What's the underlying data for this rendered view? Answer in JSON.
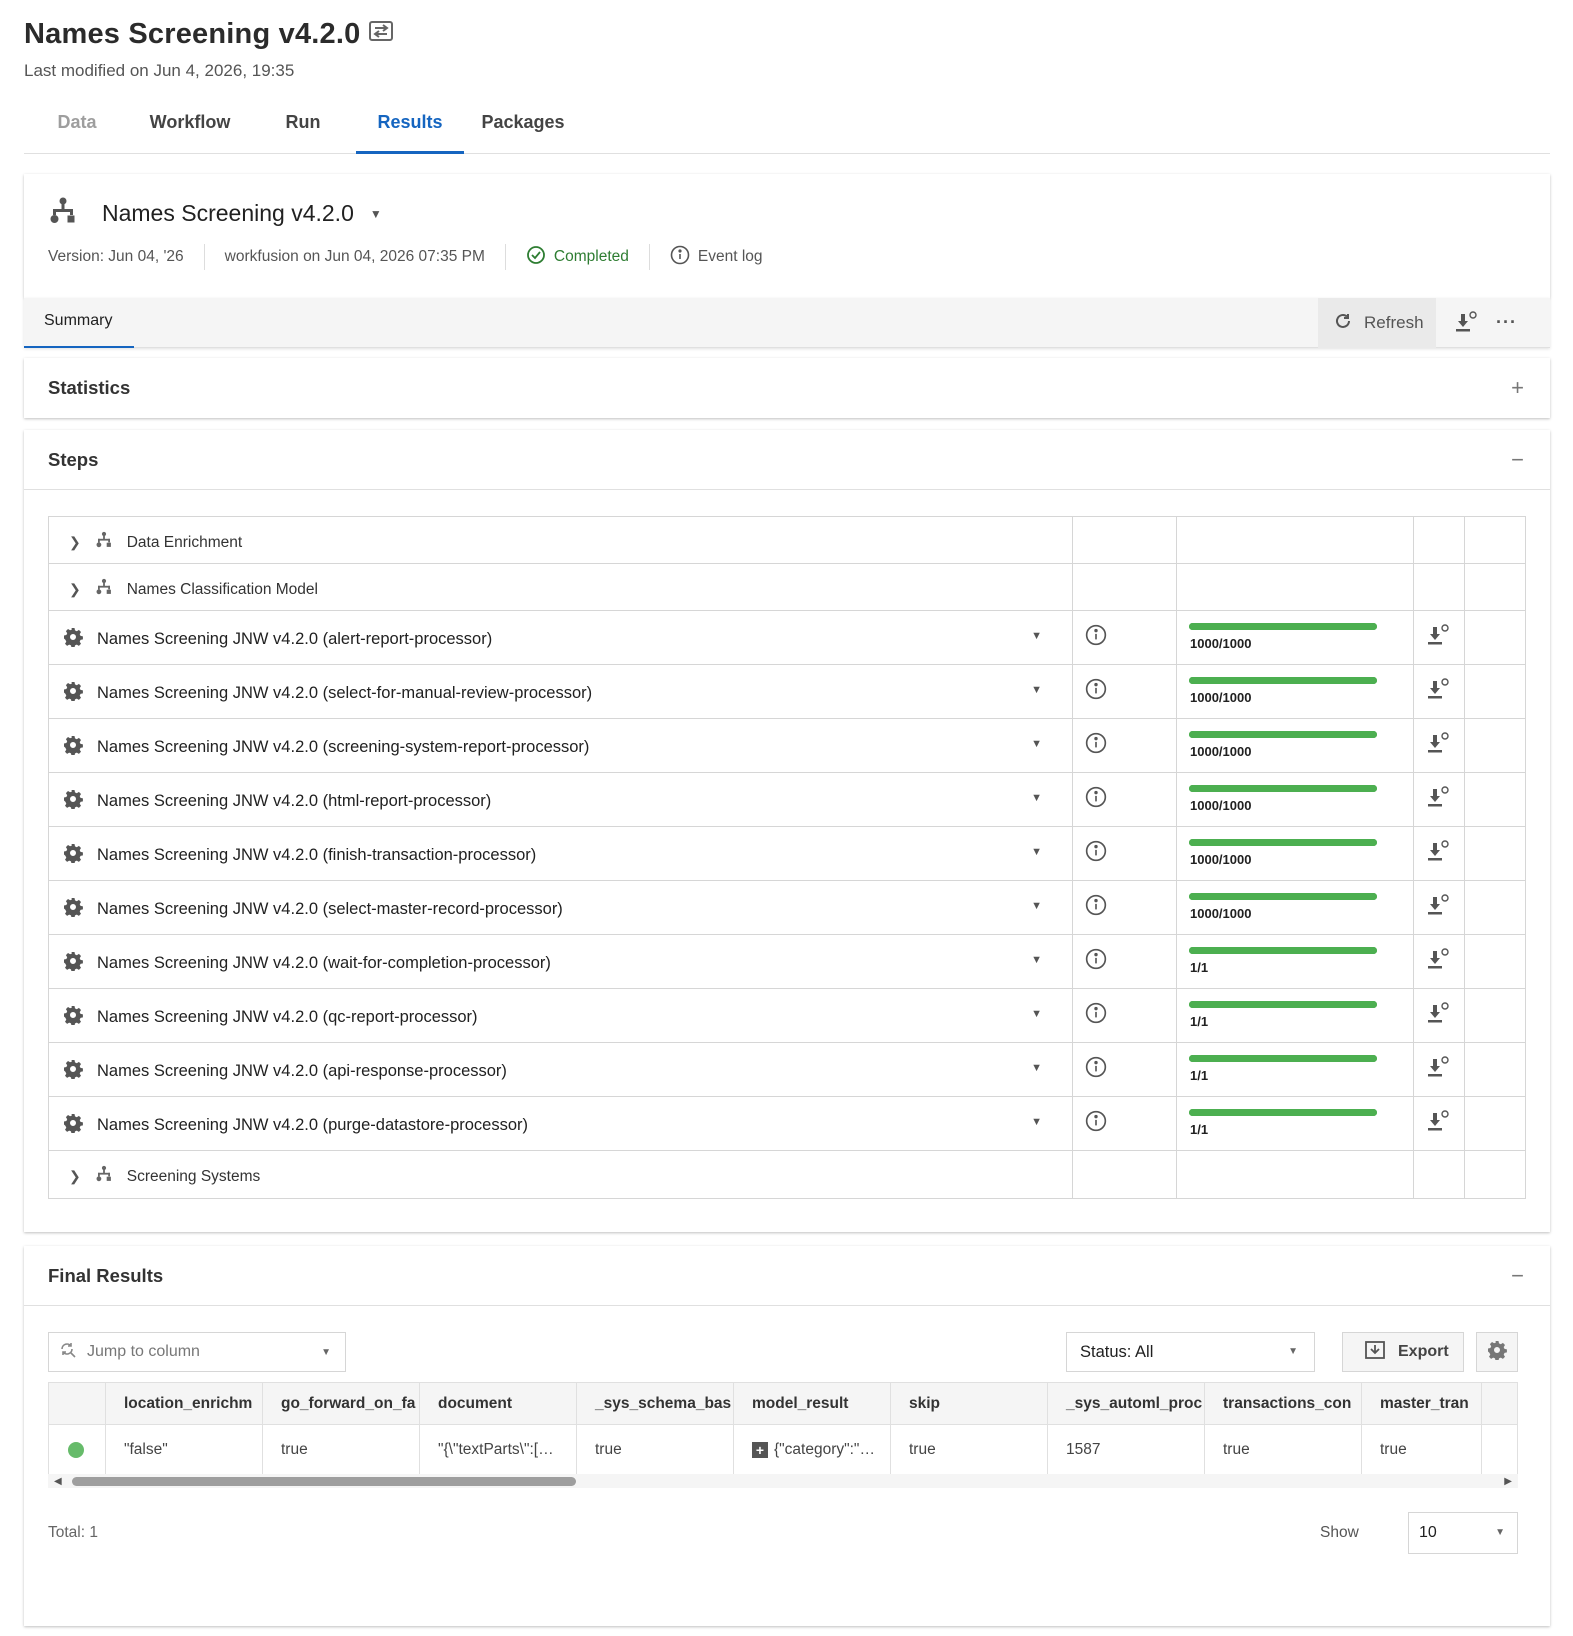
{
  "header": {
    "title": "Names Screening v4.2.0",
    "last_modified": "Last modified on Jun 4, 2026, 19:35"
  },
  "tabs": [
    {
      "label": "Data",
      "state": "disabled"
    },
    {
      "label": "Workflow",
      "state": "normal"
    },
    {
      "label": "Run",
      "state": "normal"
    },
    {
      "label": "Results",
      "state": "active"
    },
    {
      "label": "Packages",
      "state": "normal"
    }
  ],
  "run": {
    "title": "Names Screening v4.2.0",
    "version": "Version: Jun 04, '26",
    "run_by": "workfusion on Jun 04, 2026 07:35 PM",
    "status": "Completed",
    "event_log": "Event log"
  },
  "subtabs": {
    "summary": "Summary",
    "refresh": "Refresh"
  },
  "statistics": {
    "title": "Statistics",
    "toggle": "+"
  },
  "steps": {
    "title": "Steps",
    "toggle": "−",
    "groups": {
      "data_enrichment": "Data Enrichment",
      "names_classification": "Names Classification Model",
      "screening_systems": "Screening Systems"
    },
    "rows": [
      {
        "label": "Names Screening JNW v4.2.0 (alert-report-processor)",
        "progress_text": "1000/1000",
        "progress": 1.0
      },
      {
        "label": "Names Screening JNW v4.2.0 (select-for-manual-review-processor)",
        "progress_text": "1000/1000",
        "progress": 1.0
      },
      {
        "label": "Names Screening JNW v4.2.0 (screening-system-report-processor)",
        "progress_text": "1000/1000",
        "progress": 1.0
      },
      {
        "label": "Names Screening JNW v4.2.0 (html-report-processor)",
        "progress_text": "1000/1000",
        "progress": 1.0
      },
      {
        "label": "Names Screening JNW v4.2.0 (finish-transaction-processor)",
        "progress_text": "1000/1000",
        "progress": 1.0
      },
      {
        "label": "Names Screening JNW v4.2.0 (select-master-record-processor)",
        "progress_text": "1000/1000",
        "progress": 1.0
      },
      {
        "label": "Names Screening JNW v4.2.0 (wait-for-completion-processor)",
        "progress_text": "1/1",
        "progress": 1.0
      },
      {
        "label": "Names Screening JNW v4.2.0 (qc-report-processor)",
        "progress_text": "1/1",
        "progress": 1.0
      },
      {
        "label": "Names Screening JNW v4.2.0 (api-response-processor)",
        "progress_text": "1/1",
        "progress": 1.0
      },
      {
        "label": "Names Screening JNW v4.2.0 (purge-datastore-processor)",
        "progress_text": "1/1",
        "progress": 1.0
      }
    ]
  },
  "final_results": {
    "title": "Final Results",
    "toggle": "−",
    "jump_placeholder": "Jump to column",
    "status_filter": "Status: All",
    "export": "Export",
    "columns": [
      "location_enrichm",
      "go_forward_on_fa",
      "document",
      "_sys_schema_bas",
      "model_result",
      "skip",
      "_sys_automl_proc",
      "transactions_con",
      "master_tran"
    ],
    "row": [
      "\"false\"",
      "true",
      "\"{\\\"textParts\\\":[…",
      "true",
      "{\"category\":\"…",
      "true",
      "1587",
      "true",
      "true"
    ],
    "total": "Total: 1",
    "show_label": "Show",
    "show_value": "10"
  },
  "colors": {
    "accent": "#1565c0",
    "success": "#2e7d32",
    "progress": "#4caf50",
    "status_dot": "#66bb6a"
  }
}
